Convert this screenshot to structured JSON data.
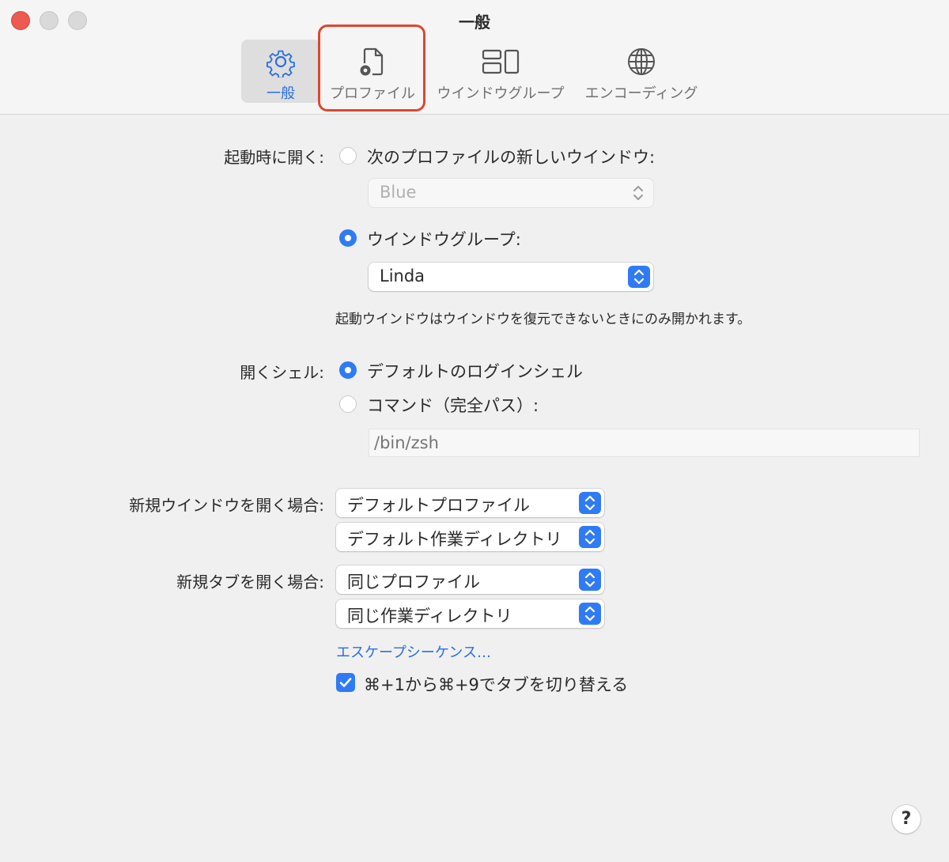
{
  "window": {
    "title": "一般"
  },
  "toolbar": {
    "tabs": [
      {
        "label": "一般",
        "icon": "gear-icon",
        "active": true
      },
      {
        "label": "プロファイル",
        "icon": "document-gear-icon",
        "active": false
      },
      {
        "label": "ウインドウグループ",
        "icon": "window-group-icon",
        "active": false
      },
      {
        "label": "エンコーディング",
        "icon": "globe-icon",
        "active": false
      }
    ]
  },
  "startup": {
    "label": "起動時に開く:",
    "option_profile_window": "次のプロファイルの新しいウインドウ:",
    "profile_select_value": "Blue",
    "option_window_group": "ウインドウグループ:",
    "window_group_select_value": "Linda",
    "note": "起動ウインドウはウインドウを復元できないときにのみ開かれます。"
  },
  "shell": {
    "label": "開くシェル:",
    "option_default": "デフォルトのログインシェル",
    "option_command": "コマンド（完全パス）:",
    "command_placeholder": "/bin/zsh"
  },
  "new_window": {
    "label": "新規ウインドウを開く場合:",
    "profile_value": "デフォルトプロファイル",
    "directory_value": "デフォルト作業ディレクトリ"
  },
  "new_tab": {
    "label": "新規タブを開く場合:",
    "profile_value": "同じプロファイル",
    "directory_value": "同じ作業ディレクトリ"
  },
  "escape_sequences_link": "エスケープシーケンス…",
  "tab_switch_checkbox": {
    "label": "⌘+1から⌘+9でタブを切り替える",
    "checked": true
  },
  "help_button": "?",
  "colors": {
    "accent": "#2f7bf5",
    "highlight": "#e0462f",
    "close": "#ed5a52"
  }
}
